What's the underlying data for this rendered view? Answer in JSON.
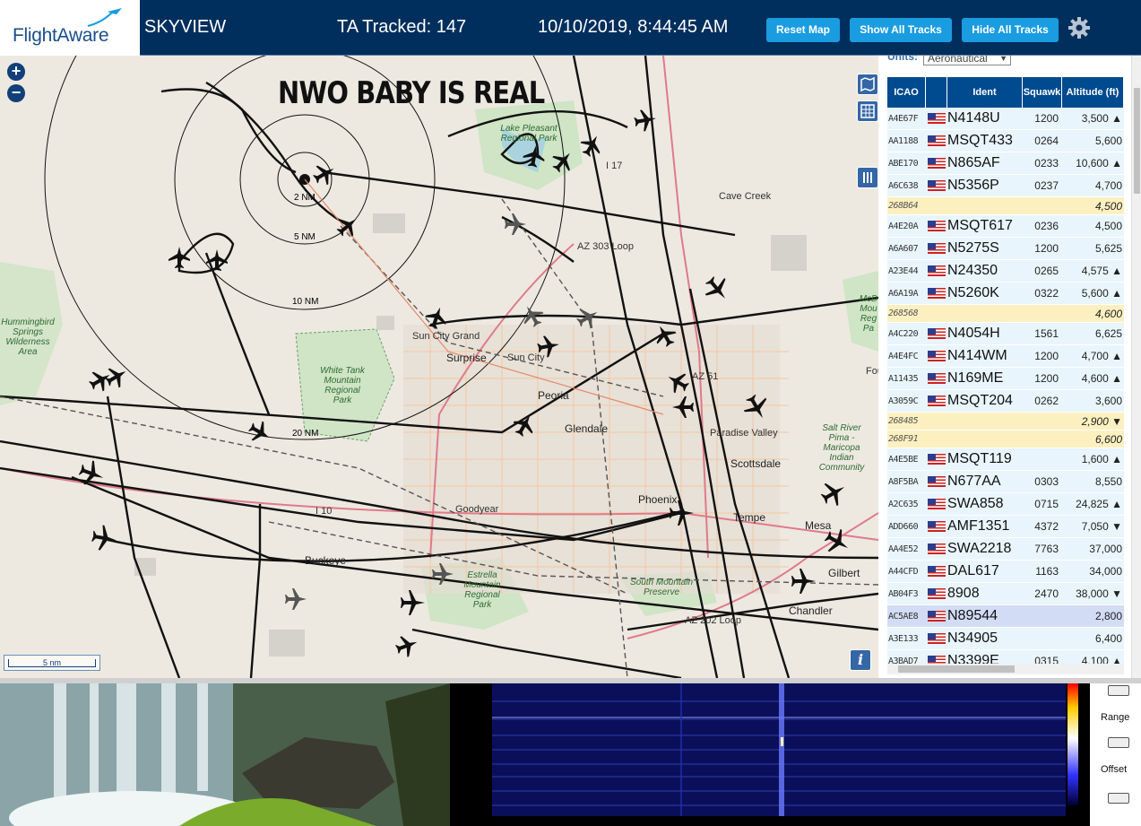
{
  "header": {
    "logo_text": "FlightAware",
    "title": "SKYVIEW",
    "tracked": "TA Tracked: 147",
    "datetime": "10/10/2019, 8:44:45 AM",
    "reset_map": "Reset Map",
    "show_all_tracks": "Show All Tracks",
    "hide_all_tracks": "Hide All Tracks",
    "settings_icon": "gear-icon"
  },
  "map": {
    "overlay_text": "NWO BABY IS REAL",
    "zoom_in": "+",
    "zoom_out": "−",
    "scale_label": "5 nm",
    "info": "i",
    "ring_labels": [
      "2 NM",
      "5 NM",
      "10 NM",
      "20 NM"
    ],
    "places": [
      "Lake Pleasant Regional Park",
      "Cave Creek",
      "AZ 303 Loop",
      "I 17",
      "Hummingbird Springs Wilderness Area",
      "White Tank Mountain Regional Park",
      "Sun City Grand",
      "Surprise",
      "Sun City",
      "Peoria",
      "Glendale",
      "Paradise Valley",
      "Scottsdale",
      "Salt River Pima - Maricopa Indian Community",
      "Goodyear",
      "I 10",
      "Phoenix",
      "Tempe",
      "Mesa",
      "Buckeye",
      "Estrella Mountain Regional Park",
      "South Mountain Preserve",
      "Gilbert",
      "Chandler",
      "AZ 202 Loop",
      "AZ 51",
      "McD Mou Reg Pa",
      "Fou"
    ]
  },
  "sidebar": {
    "units_label": "Units:",
    "units_value": "Aeronautical",
    "columns": [
      "ICAO",
      "",
      "Ident",
      "Squawk",
      "Altitude (ft)"
    ],
    "rows": [
      {
        "icao": "A4E67F",
        "flag": true,
        "ident": "N4148U",
        "squawk": "1200",
        "alt": "3,500 ▲",
        "style": "norm"
      },
      {
        "icao": "AA1188",
        "flag": true,
        "ident": "MSQT433",
        "squawk": "0264",
        "alt": "5,600",
        "style": "norm"
      },
      {
        "icao": "ABE170",
        "flag": true,
        "ident": "N865AF",
        "squawk": "0233",
        "alt": "10,600 ▲",
        "style": "norm"
      },
      {
        "icao": "A6C638",
        "flag": true,
        "ident": "N5356P",
        "squawk": "0237",
        "alt": "4,700",
        "style": "norm"
      },
      {
        "icao": "268B64",
        "flag": false,
        "ident": "",
        "squawk": "",
        "alt": "4,500",
        "style": "yel"
      },
      {
        "icao": "A4E20A",
        "flag": true,
        "ident": "MSQT617",
        "squawk": "0236",
        "alt": "4,500",
        "style": "norm"
      },
      {
        "icao": "A6A607",
        "flag": true,
        "ident": "N5275S",
        "squawk": "1200",
        "alt": "5,625",
        "style": "norm"
      },
      {
        "icao": "A23E44",
        "flag": true,
        "ident": "N24350",
        "squawk": "0265",
        "alt": "4,575 ▲",
        "style": "norm"
      },
      {
        "icao": "A6A19A",
        "flag": true,
        "ident": "N5260K",
        "squawk": "0322",
        "alt": "5,600 ▲",
        "style": "norm"
      },
      {
        "icao": "268568",
        "flag": false,
        "ident": "",
        "squawk": "",
        "alt": "4,600",
        "style": "yel"
      },
      {
        "icao": "A4C220",
        "flag": true,
        "ident": "N4054H",
        "squawk": "1561",
        "alt": "6,625",
        "style": "norm"
      },
      {
        "icao": "A4E4FC",
        "flag": true,
        "ident": "N414WM",
        "squawk": "1200",
        "alt": "4,700 ▲",
        "style": "norm"
      },
      {
        "icao": "A11435",
        "flag": true,
        "ident": "N169ME",
        "squawk": "1200",
        "alt": "4,600 ▲",
        "style": "norm"
      },
      {
        "icao": "A3059C",
        "flag": true,
        "ident": "MSQT204",
        "squawk": "0262",
        "alt": "3,600",
        "style": "norm"
      },
      {
        "icao": "268485",
        "flag": false,
        "ident": "",
        "squawk": "",
        "alt": "2,900 ▼",
        "style": "yel"
      },
      {
        "icao": "268F91",
        "flag": false,
        "ident": "",
        "squawk": "",
        "alt": "6,600",
        "style": "yel"
      },
      {
        "icao": "A4E5BE",
        "flag": true,
        "ident": "MSQT119",
        "squawk": "",
        "alt": "1,600 ▲",
        "style": "norm"
      },
      {
        "icao": "A8F5BA",
        "flag": true,
        "ident": "N677AA",
        "squawk": "0303",
        "alt": "8,550",
        "style": "norm"
      },
      {
        "icao": "A2C635",
        "flag": true,
        "ident": "SWA858",
        "squawk": "0715",
        "alt": "24,825 ▲",
        "style": "norm"
      },
      {
        "icao": "ADD660",
        "flag": true,
        "ident": "AMF1351",
        "squawk": "4372",
        "alt": "7,050 ▼",
        "style": "norm"
      },
      {
        "icao": "AA4E52",
        "flag": true,
        "ident": "SWA2218",
        "squawk": "7763",
        "alt": "37,000",
        "style": "norm"
      },
      {
        "icao": "A44CFD",
        "flag": true,
        "ident": "DAL617",
        "squawk": "1163",
        "alt": "34,000",
        "style": "norm"
      },
      {
        "icao": "AB04F3",
        "flag": true,
        "ident": "8908",
        "squawk": "2470",
        "alt": "38,000 ▼",
        "style": "norm"
      },
      {
        "icao": "AC5AE8",
        "flag": true,
        "ident": "N89544",
        "squawk": "",
        "alt": "2,800",
        "style": "sel"
      },
      {
        "icao": "A3E133",
        "flag": true,
        "ident": "N34905",
        "squawk": "",
        "alt": "6,400",
        "style": "norm"
      },
      {
        "icao": "A3BAD7",
        "flag": true,
        "ident": "N3399E",
        "squawk": "0315",
        "alt": "4,100 ▲",
        "style": "norm"
      }
    ]
  },
  "spectrum": {
    "range_label": "Range",
    "offset_label": "Offset"
  },
  "colors": {
    "header_bg": "#002f5d",
    "button": "#1a9ce0",
    "table_header": "#004a8f",
    "row_normal": "#e9f5fc",
    "row_unknown": "#fcf0c0",
    "row_selected": "#d2dcf4"
  }
}
